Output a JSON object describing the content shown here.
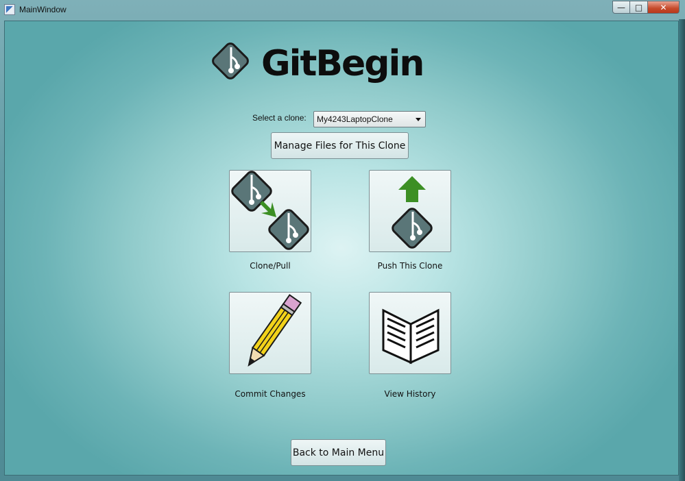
{
  "window": {
    "title": "MainWindow",
    "controls": {
      "minimize": "—",
      "maximize": "□",
      "close": "✕"
    }
  },
  "logo": {
    "text": "GitBegin",
    "icon": "git-branch-diamond-icon"
  },
  "clone_selector": {
    "label": "Select a clone:",
    "selected": "My4243LaptopClone"
  },
  "manage_button": {
    "label": "Manage Files for This Clone"
  },
  "tiles": [
    {
      "label": "Clone/Pull",
      "icon": "clone-pull-icon"
    },
    {
      "label": "Push This Clone",
      "icon": "push-icon"
    },
    {
      "label": "Commit Changes",
      "icon": "pencil-icon"
    },
    {
      "label": "View History",
      "icon": "open-book-icon"
    }
  ],
  "back_button": {
    "label": "Back to Main Menu"
  },
  "colors": {
    "diamond": "#5a7678",
    "arrow_green": "#3c8f24",
    "pencil_yellow": "#f2d21a",
    "eraser": "#d9a3cf"
  }
}
